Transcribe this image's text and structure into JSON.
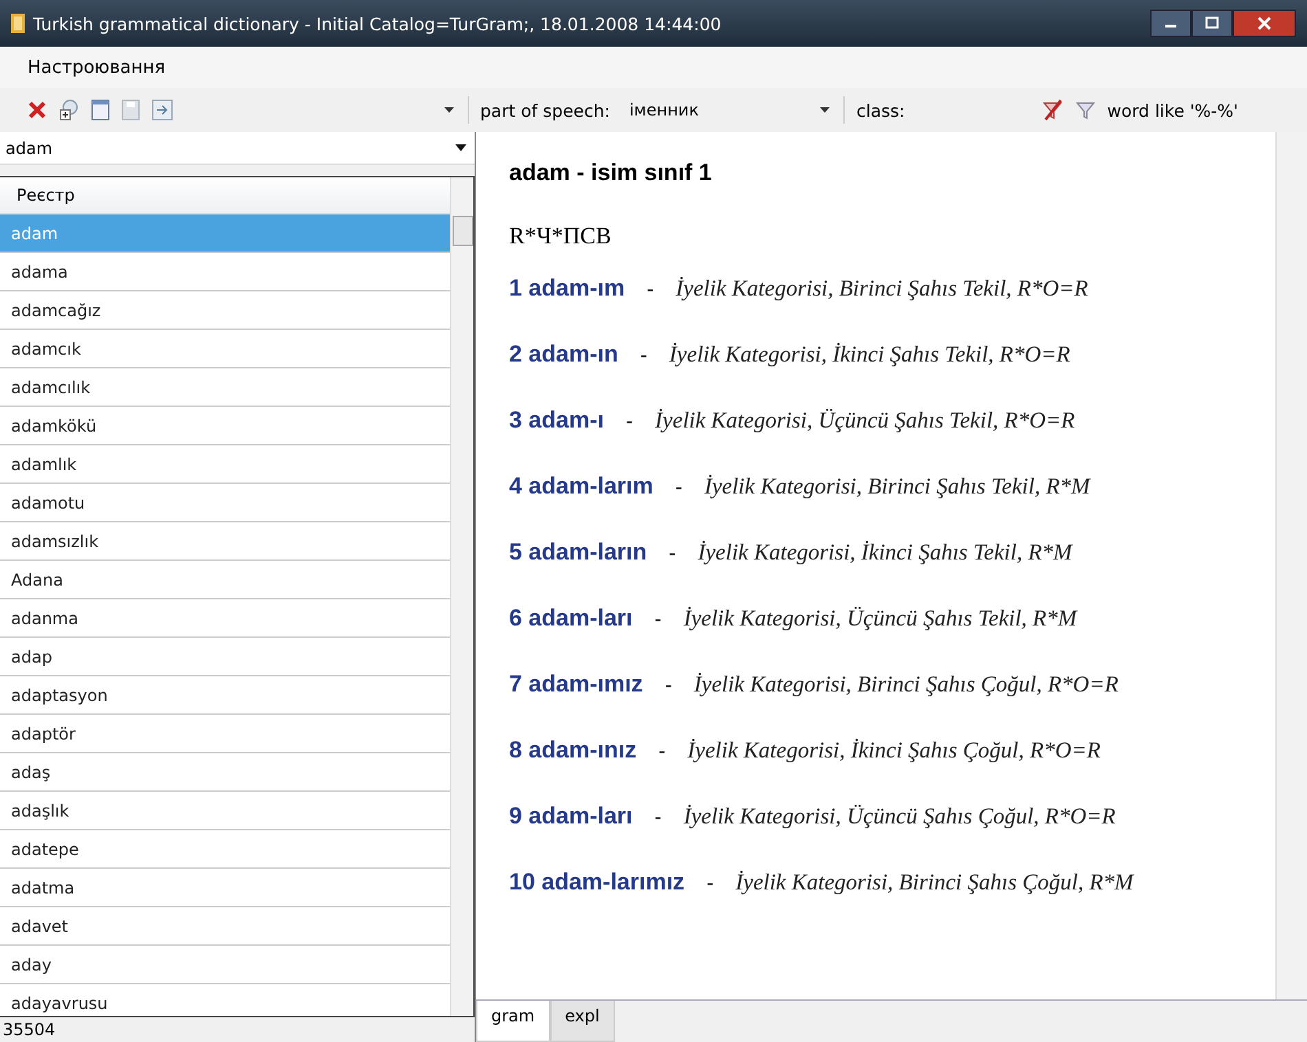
{
  "window": {
    "title": "Turkish grammatical dictionary - Initial Catalog=TurGram;, 18.01.2008 14:44:00"
  },
  "menu": [
    "Настроювання"
  ],
  "toolbar": {
    "part_of_speech_label": "part of speech:",
    "part_of_speech_value": "іменник",
    "class_label": "class:",
    "filter_label": "word like '%-%'"
  },
  "word_combo": {
    "value": "adam"
  },
  "list": {
    "header": "Реєстр",
    "items": [
      {
        "text": "adam",
        "selected": true
      },
      {
        "text": "adama",
        "selected": false
      },
      {
        "text": "adamcağız",
        "selected": false
      },
      {
        "text": "adamcık",
        "selected": false
      },
      {
        "text": "adamcılık",
        "selected": false
      },
      {
        "text": "adamkökü",
        "selected": false
      },
      {
        "text": "adamlık",
        "selected": false
      },
      {
        "text": "adamotu",
        "selected": false
      },
      {
        "text": "adamsızlık",
        "selected": false
      },
      {
        "text": "Adana",
        "selected": false
      },
      {
        "text": "adanma",
        "selected": false
      },
      {
        "text": "adap",
        "selected": false
      },
      {
        "text": "adaptasyon",
        "selected": false
      },
      {
        "text": "adaptör",
        "selected": false
      },
      {
        "text": "adaş",
        "selected": false
      },
      {
        "text": "adaşlık",
        "selected": false
      },
      {
        "text": "adatepe",
        "selected": false
      },
      {
        "text": "adatma",
        "selected": false
      },
      {
        "text": "adavet",
        "selected": false
      },
      {
        "text": "aday",
        "selected": false
      },
      {
        "text": "adayavrusu",
        "selected": false
      }
    ]
  },
  "entry": {
    "heading": "adam - isim sınıf 1",
    "code": "R*Ч*ПСВ",
    "forms": [
      {
        "form": "1 adam-ım",
        "separator": "-",
        "description": "İyelik Kategorisi, Birinci Şahıs Tekil, R*O=R"
      },
      {
        "form": "2 adam-ın",
        "separator": "-",
        "description": "İyelik Kategorisi, İkinci Şahıs Tekil, R*O=R"
      },
      {
        "form": "3 adam-ı",
        "separator": "-",
        "description": "İyelik Kategorisi, Üçüncü Şahıs Tekil, R*O=R"
      },
      {
        "form": "4 adam-larım",
        "separator": "-",
        "description": "İyelik Kategorisi, Birinci Şahıs Tekil, R*M"
      },
      {
        "form": "5 adam-ların",
        "separator": "-",
        "description": "İyelik Kategorisi, İkinci Şahıs Tekil, R*M"
      },
      {
        "form": "6 adam-ları",
        "separator": "-",
        "description": "İyelik Kategorisi, Üçüncü Şahıs Tekil, R*M"
      },
      {
        "form": "7 adam-ımız",
        "separator": "-",
        "description": "İyelik Kategorisi, Birinci Şahıs Çoğul, R*O=R"
      },
      {
        "form": "8 adam-ınız",
        "separator": "-",
        "description": "İyelik Kategorisi, İkinci Şahıs Çoğul, R*O=R"
      },
      {
        "form": "9 adam-ları",
        "separator": "-",
        "description": "İyelik Kategorisi, Üçüncü Şahıs Çoğul, R*O=R"
      },
      {
        "form": "10 adam-larımız",
        "separator": "-",
        "description": "İyelik Kategorisi, Birinci Şahıs Çoğul, R*M"
      }
    ]
  },
  "tabs": [
    {
      "label": "gram",
      "selected": true
    },
    {
      "label": "expl",
      "selected": false
    }
  ],
  "status_bar": "35504"
}
